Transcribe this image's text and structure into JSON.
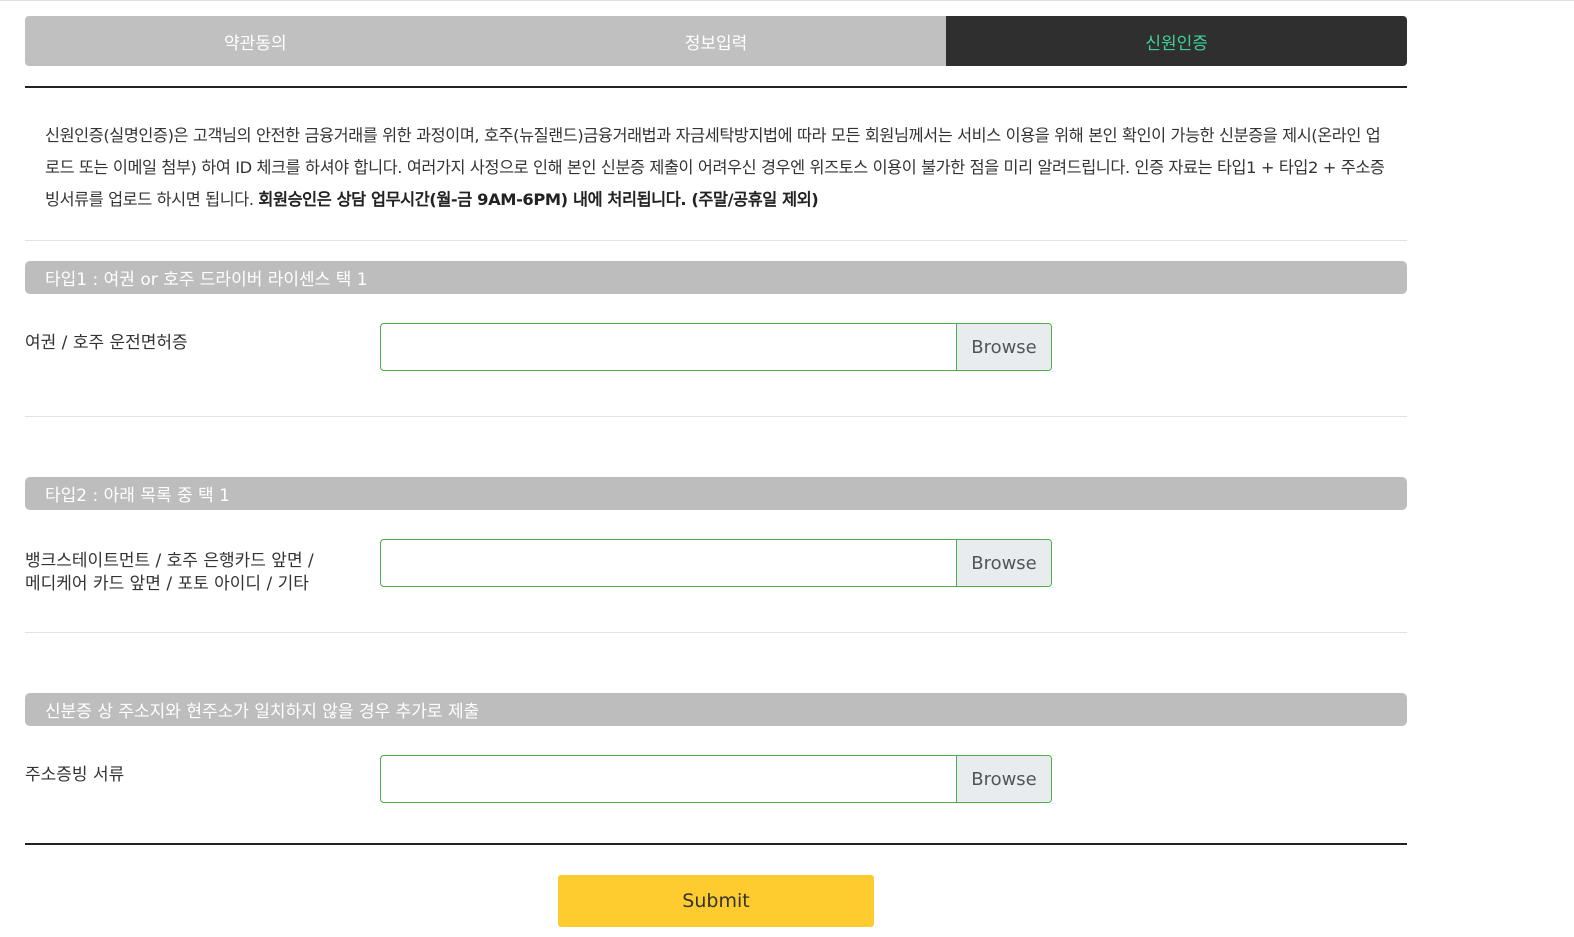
{
  "steps": [
    {
      "label": "약관동의",
      "active": false
    },
    {
      "label": "정보입력",
      "active": false
    },
    {
      "label": "신원인증",
      "active": true
    }
  ],
  "intro": {
    "text": "신원인증(실명인증)은 고객님의 안전한 금융거래를 위한 과정이며, 호주(뉴질랜드)금융거래법과 자금세탁방지법에 따라 모든 회원님께서는 서비스 이용을 위해 본인 확인이 가능한 신분증을 제시(온라인 업로드 또는 이메일 첨부) 하여 ID 체크를 하셔야 합니다. 여러가지 사정으로 인해 본인 신분증 제출이 어려우신 경우엔 위즈토스 이용이 불가한 점을 미리 알려드립니다. 인증 자료는 타입1 + 타입2 + 주소증빙서류를 업로드 하시면 됩니다. ",
    "strong": "회원승인은 상담 업무시간(월-금 9AM-6PM) 내에 처리됩니다. (주말/공휴일 제외)"
  },
  "sections": [
    {
      "header": "타입1 : 여권 or 호주 드라이버 라이센스 택 1",
      "label_line1": "여권 / 호주 운전면허증",
      "label_line2": "",
      "browse": "Browse"
    },
    {
      "header": "타입2 : 아래 목록 중 택 1",
      "label_line1": "뱅크스테이트먼트 / 호주 은행카드 앞면 /",
      "label_line2": "메디케어 카드 앞면 / 포토 아이디 / 기타",
      "browse": "Browse"
    },
    {
      "header": "신분증 상 주소지와 현주소가 일치하지 않을 경우 추가로 제출",
      "label_line1": "주소증빙 서류",
      "label_line2": "",
      "browse": "Browse"
    }
  ],
  "submit_label": "Submit",
  "colors": {
    "active_step_bg": "#2f2f2f",
    "active_step_text": "#3fd09a",
    "inactive_step_bg": "#c0c0c0",
    "section_header_bg": "#bdbdbd",
    "input_border": "#4cae4c",
    "submit_bg": "#ffcc2f"
  }
}
